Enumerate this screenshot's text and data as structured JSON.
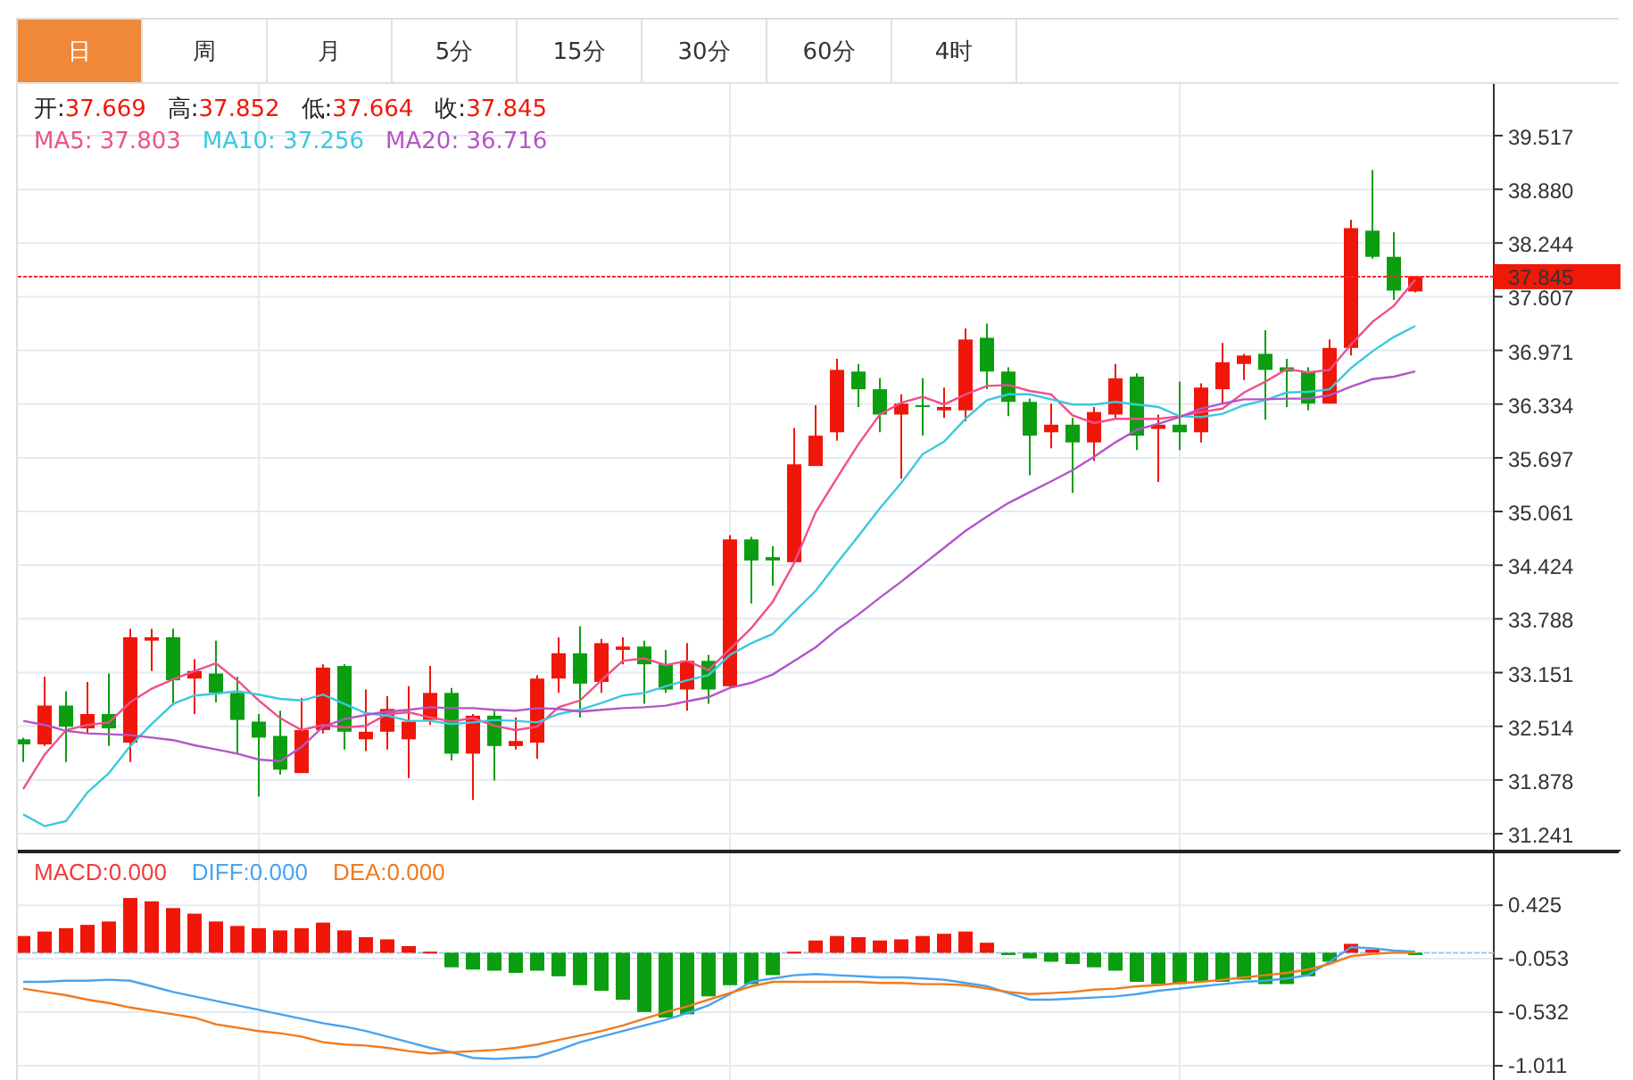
{
  "tabs": [
    {
      "label": "日",
      "selected": true
    },
    {
      "label": "周",
      "selected": false
    },
    {
      "label": "月",
      "selected": false
    },
    {
      "label": "5分",
      "selected": false
    },
    {
      "label": "15分",
      "selected": false
    },
    {
      "label": "30分",
      "selected": false
    },
    {
      "label": "60分",
      "selected": false
    },
    {
      "label": "4时",
      "selected": false
    }
  ],
  "price_panel": {
    "ohlc": [
      {
        "label": "开:",
        "value": "37.669"
      },
      {
        "label": "高:",
        "value": "37.852"
      },
      {
        "label": "低:",
        "value": "37.664"
      },
      {
        "label": "收:",
        "value": "37.845"
      }
    ],
    "moving_averages": [
      {
        "text": "MA5: 37.803",
        "color": "#f0508a"
      },
      {
        "text": "MA10: 37.256",
        "color": "#3cc8de"
      },
      {
        "text": "MA20: 36.716",
        "color": "#b455c8"
      }
    ],
    "chart_data": {
      "type": "candlestick",
      "grid": true,
      "ylim": [
        31.03,
        40.13
      ],
      "yticks": [
        31.241,
        31.878,
        32.514,
        33.151,
        33.788,
        34.424,
        35.061,
        35.697,
        36.334,
        36.971,
        37.607,
        38.244,
        {
          "value": 38.88,
          "label": "38.880"
        },
        39.517
      ],
      "ref_lines": [
        {
          "axis": "y",
          "value": 37.845,
          "label": "37.845"
        }
      ],
      "ohlc": [
        [
          32.36,
          32.38,
          32.09,
          32.3
        ],
        [
          32.3,
          33.1,
          32.28,
          32.76
        ],
        [
          32.76,
          32.93,
          32.09,
          32.51
        ],
        [
          32.49,
          33.04,
          32.43,
          32.66
        ],
        [
          32.66,
          33.14,
          32.28,
          32.49
        ],
        [
          32.32,
          33.67,
          32.09,
          33.57
        ],
        [
          33.53,
          33.67,
          33.17,
          33.57
        ],
        [
          33.57,
          33.67,
          32.76,
          33.06
        ],
        [
          33.08,
          33.31,
          32.66,
          33.17
        ],
        [
          33.14,
          33.53,
          32.8,
          32.91
        ],
        [
          32.91,
          33.1,
          32.19,
          32.59
        ],
        [
          32.57,
          32.66,
          31.68,
          32.38
        ],
        [
          32.4,
          32.7,
          31.94,
          32.0
        ],
        [
          31.96,
          32.85,
          31.96,
          32.47
        ],
        [
          32.47,
          33.25,
          32.43,
          33.21
        ],
        [
          33.23,
          33.25,
          32.24,
          32.45
        ],
        [
          32.36,
          32.95,
          32.22,
          32.45
        ],
        [
          32.45,
          32.87,
          32.24,
          32.72
        ],
        [
          32.36,
          32.99,
          31.9,
          32.57
        ],
        [
          32.59,
          33.23,
          32.53,
          32.91
        ],
        [
          32.91,
          32.97,
          32.11,
          32.19
        ],
        [
          32.19,
          32.66,
          31.64,
          32.64
        ],
        [
          32.64,
          32.7,
          31.87,
          32.28
        ],
        [
          32.28,
          32.62,
          32.24,
          32.34
        ],
        [
          32.32,
          33.12,
          32.13,
          33.08
        ],
        [
          33.08,
          33.57,
          32.91,
          33.38
        ],
        [
          33.38,
          33.7,
          32.62,
          33.02
        ],
        [
          33.04,
          33.55,
          32.91,
          33.5
        ],
        [
          33.42,
          33.57,
          33.25,
          33.46
        ],
        [
          33.46,
          33.53,
          32.78,
          33.25
        ],
        [
          33.25,
          33.42,
          32.91,
          32.95
        ],
        [
          32.95,
          33.5,
          32.7,
          33.29
        ],
        [
          33.29,
          33.36,
          32.78,
          32.95
        ],
        [
          32.99,
          34.78,
          32.97,
          34.73
        ],
        [
          34.73,
          34.76,
          33.97,
          34.48
        ],
        [
          34.52,
          34.65,
          34.18,
          34.48
        ],
        [
          34.46,
          36.05,
          34.44,
          35.62
        ],
        [
          35.6,
          36.32,
          35.6,
          35.96
        ],
        [
          36.0,
          36.87,
          35.9,
          36.74
        ],
        [
          36.72,
          36.81,
          36.3,
          36.51
        ],
        [
          36.51,
          36.64,
          36.0,
          36.21
        ],
        [
          36.21,
          36.45,
          35.45,
          36.34
        ],
        [
          36.32,
          36.64,
          35.96,
          36.3
        ],
        [
          36.26,
          36.53,
          36.17,
          36.3
        ],
        [
          36.26,
          37.23,
          36.13,
          37.1
        ],
        [
          37.12,
          37.29,
          36.51,
          36.72
        ],
        [
          36.72,
          36.77,
          36.19,
          36.36
        ],
        [
          36.36,
          36.4,
          35.49,
          35.96
        ],
        [
          36.0,
          36.34,
          35.81,
          36.09
        ],
        [
          36.09,
          36.17,
          35.28,
          35.88
        ],
        [
          35.88,
          36.3,
          35.66,
          36.24
        ],
        [
          36.21,
          36.81,
          36.17,
          36.64
        ],
        [
          36.66,
          36.7,
          35.79,
          35.96
        ],
        [
          36.04,
          36.21,
          35.41,
          36.09
        ],
        [
          36.09,
          36.6,
          35.79,
          36.0
        ],
        [
          36.0,
          36.58,
          35.88,
          36.53
        ],
        [
          36.51,
          37.06,
          36.34,
          36.83
        ],
        [
          36.81,
          36.93,
          36.62,
          36.91
        ],
        [
          36.93,
          37.21,
          36.15,
          36.74
        ],
        [
          36.77,
          36.87,
          36.3,
          36.72
        ],
        [
          36.72,
          36.77,
          36.26,
          36.34
        ],
        [
          36.34,
          37.1,
          36.34,
          37.0
        ],
        [
          37.0,
          38.52,
          36.91,
          38.42
        ],
        [
          38.39,
          39.11,
          38.06,
          38.08
        ],
        [
          38.08,
          38.37,
          37.57,
          37.68
        ],
        [
          37.67,
          37.85,
          37.66,
          37.85
        ]
      ],
      "series": [
        {
          "type": "line",
          "color": "#f0508a",
          "values": [
            31.77,
            32.18,
            32.47,
            32.53,
            32.56,
            32.8,
            32.96,
            33.07,
            33.17,
            33.26,
            33.06,
            32.82,
            32.61,
            32.47,
            32.53,
            32.5,
            32.52,
            32.66,
            32.68,
            32.62,
            32.57,
            32.61,
            32.52,
            32.47,
            32.51,
            32.74,
            32.82,
            33.06,
            33.29,
            33.32,
            33.24,
            33.29,
            33.18,
            33.43,
            33.68,
            33.99,
            34.45,
            35.05,
            35.46,
            35.86,
            36.21,
            36.35,
            36.42,
            36.33,
            36.45,
            36.55,
            36.56,
            36.49,
            36.45,
            36.2,
            36.11,
            36.16,
            36.16,
            36.16,
            36.19,
            36.24,
            36.28,
            36.47,
            36.6,
            36.75,
            36.71,
            36.74,
            37.04,
            37.31,
            37.5,
            37.81
          ]
        },
        {
          "type": "line",
          "color": "#3cc8de",
          "values": [
            31.47,
            31.33,
            31.39,
            31.73,
            31.96,
            32.28,
            32.54,
            32.78,
            32.88,
            32.9,
            32.93,
            32.89,
            32.84,
            32.82,
            32.89,
            32.78,
            32.67,
            32.64,
            32.58,
            32.58,
            32.54,
            32.56,
            32.59,
            32.58,
            32.56,
            32.66,
            32.71,
            32.79,
            32.88,
            32.91,
            32.99,
            33.06,
            33.12,
            33.36,
            33.5,
            33.61,
            33.87,
            34.12,
            34.45,
            34.77,
            35.1,
            35.4,
            35.74,
            35.89,
            36.16,
            36.38,
            36.45,
            36.45,
            36.39,
            36.33,
            36.33,
            36.36,
            36.33,
            36.3,
            36.19,
            36.18,
            36.22,
            36.32,
            36.38,
            36.47,
            36.48,
            36.51,
            36.76,
            36.96,
            37.13,
            37.26
          ]
        },
        {
          "type": "line",
          "color": "#b455c8",
          "values": [
            32.58,
            32.53,
            32.46,
            32.43,
            32.42,
            32.41,
            32.38,
            32.35,
            32.29,
            32.24,
            32.19,
            32.12,
            32.1,
            32.27,
            32.51,
            32.6,
            32.65,
            32.69,
            32.71,
            32.74,
            32.73,
            32.73,
            32.71,
            32.7,
            32.73,
            32.72,
            32.69,
            32.71,
            32.73,
            32.74,
            32.76,
            32.81,
            32.86,
            32.97,
            33.03,
            33.13,
            33.29,
            33.45,
            33.66,
            33.84,
            34.04,
            34.23,
            34.43,
            34.63,
            34.83,
            35.0,
            35.16,
            35.29,
            35.42,
            35.55,
            35.71,
            35.88,
            36.03,
            36.1,
            36.18,
            36.28,
            36.34,
            36.39,
            36.39,
            36.4,
            36.4,
            36.44,
            36.54,
            36.63,
            36.66,
            36.72
          ]
        }
      ]
    }
  },
  "macd_panel": {
    "legend": [
      {
        "text": "MACD:0.000",
        "color": "#f03c3c"
      },
      {
        "text": "DIFF:0.000",
        "color": "#4aa3ee"
      },
      {
        "text": "DEA:0.000",
        "color": "#f07a1e"
      }
    ],
    "chart_data": {
      "type": "bar",
      "grid": true,
      "ylim": [
        -1.17,
        0.89
      ],
      "yticks": [
        0.425,
        -0.053,
        -0.532,
        -1.011
      ],
      "ref_lines": [
        {
          "axis": "y",
          "value": 0
        }
      ],
      "series": [
        {
          "color": "#f0160a",
          "values": [
            0.15,
            0.19,
            0.22,
            0.25,
            0.28,
            0.49,
            0.46,
            0.4,
            0.35,
            0.28,
            0.24,
            0.22,
            0.2,
            0.22,
            0.27,
            0.2,
            0.14,
            0.12,
            0.06,
            0.01,
            null,
            null,
            null,
            null,
            null,
            null,
            null,
            null,
            null,
            null,
            null,
            null,
            null,
            null,
            null,
            null,
            0.01,
            0.11,
            0.15,
            0.14,
            0.11,
            0.12,
            0.15,
            0.17,
            0.19,
            0.09,
            null,
            null,
            null,
            null,
            null,
            null,
            null,
            null,
            null,
            null,
            null,
            null,
            null,
            null,
            null,
            null,
            0.08,
            0.03,
            null,
            null
          ]
        },
        {
          "color": "#0a9e10",
          "values": [
            null,
            null,
            null,
            null,
            null,
            null,
            null,
            null,
            null,
            null,
            null,
            null,
            null,
            null,
            null,
            null,
            null,
            null,
            null,
            null,
            -0.13,
            -0.15,
            -0.16,
            -0.18,
            -0.16,
            -0.21,
            -0.29,
            -0.34,
            -0.42,
            -0.53,
            -0.58,
            -0.55,
            -0.39,
            -0.29,
            -0.28,
            -0.2,
            null,
            null,
            null,
            null,
            null,
            null,
            null,
            null,
            null,
            null,
            -0.02,
            -0.05,
            -0.08,
            -0.1,
            -0.13,
            -0.16,
            -0.26,
            -0.28,
            -0.28,
            -0.26,
            -0.26,
            -0.24,
            -0.28,
            -0.28,
            -0.21,
            -0.08,
            null,
            null,
            null,
            -0.02
          ]
        },
        {
          "type": "line",
          "color": "#4aa3ee",
          "values": [
            -0.26,
            -0.26,
            -0.25,
            -0.25,
            -0.24,
            -0.25,
            -0.3,
            -0.35,
            -0.39,
            -0.43,
            -0.47,
            -0.51,
            -0.55,
            -0.59,
            -0.63,
            -0.66,
            -0.7,
            -0.75,
            -0.8,
            -0.85,
            -0.89,
            -0.94,
            -0.95,
            -0.94,
            -0.93,
            -0.87,
            -0.8,
            -0.75,
            -0.7,
            -0.65,
            -0.6,
            -0.54,
            -0.47,
            -0.37,
            -0.26,
            -0.23,
            -0.2,
            -0.19,
            -0.2,
            -0.21,
            -0.22,
            -0.22,
            -0.23,
            -0.24,
            -0.27,
            -0.3,
            -0.36,
            -0.42,
            -0.42,
            -0.41,
            -0.4,
            -0.39,
            -0.37,
            -0.34,
            -0.32,
            -0.3,
            -0.28,
            -0.26,
            -0.25,
            -0.23,
            -0.2,
            -0.08,
            0.05,
            0.04,
            0.02,
            0.01
          ]
        },
        {
          "type": "line",
          "color": "#f07a1e",
          "values": [
            -0.32,
            -0.35,
            -0.38,
            -0.42,
            -0.45,
            -0.49,
            -0.52,
            -0.55,
            -0.58,
            -0.64,
            -0.67,
            -0.7,
            -0.72,
            -0.75,
            -0.8,
            -0.82,
            -0.83,
            -0.85,
            -0.88,
            -0.9,
            -0.89,
            -0.88,
            -0.87,
            -0.85,
            -0.82,
            -0.78,
            -0.74,
            -0.7,
            -0.65,
            -0.59,
            -0.53,
            -0.48,
            -0.42,
            -0.36,
            -0.3,
            -0.26,
            -0.26,
            -0.26,
            -0.26,
            -0.26,
            -0.27,
            -0.27,
            -0.28,
            -0.28,
            -0.29,
            -0.32,
            -0.35,
            -0.37,
            -0.36,
            -0.35,
            -0.33,
            -0.32,
            -0.3,
            -0.29,
            -0.27,
            -0.26,
            -0.24,
            -0.22,
            -0.2,
            -0.18,
            -0.15,
            -0.1,
            -0.03,
            -0.01,
            0.0,
            0.0
          ]
        }
      ]
    }
  }
}
